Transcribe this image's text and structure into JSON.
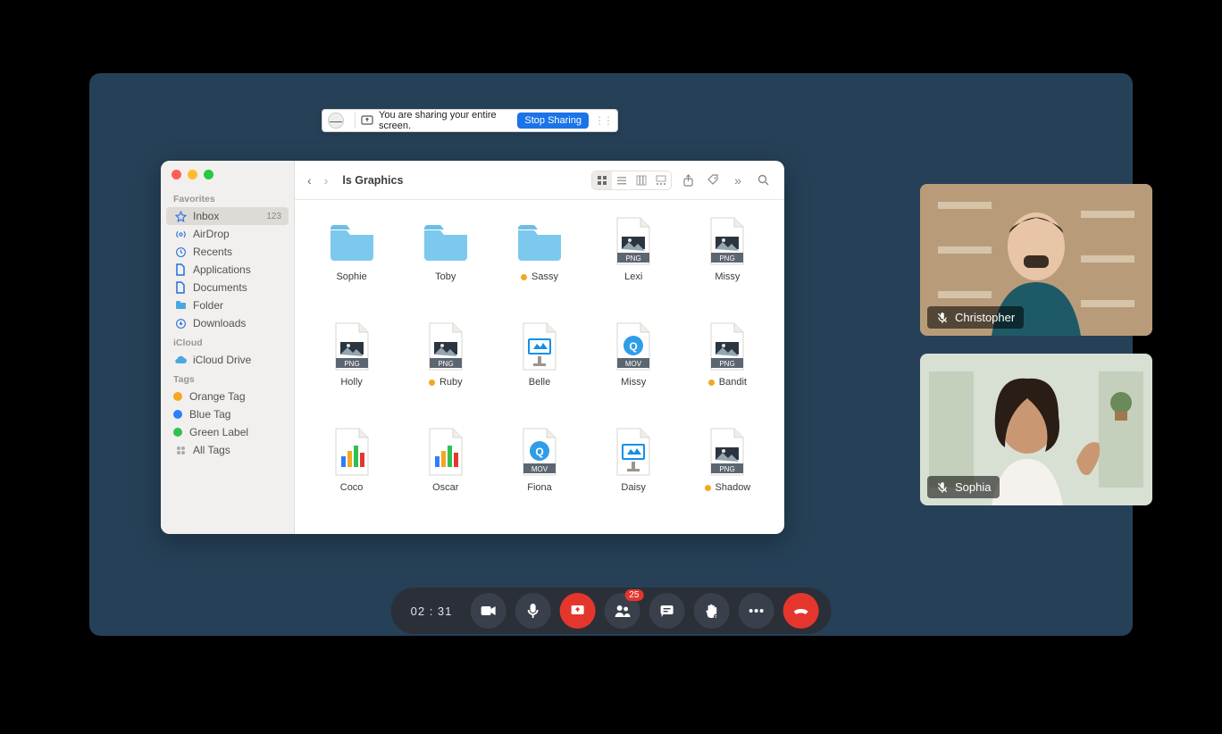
{
  "share_bar": {
    "message": "You are sharing your entire screen.",
    "stop_label": "Stop Sharing",
    "collapse_glyph": "—"
  },
  "finder": {
    "title": "ls Graphics",
    "sidebar": {
      "sections": [
        {
          "header": "Favorites",
          "items": [
            {
              "icon": "star",
              "label": "Inbox",
              "badge": "123",
              "selected": true
            },
            {
              "icon": "airdrop",
              "label": "AirDrop"
            },
            {
              "icon": "clock",
              "label": "Recents"
            },
            {
              "icon": "doc",
              "label": "Applications"
            },
            {
              "icon": "doc",
              "label": "Documents"
            },
            {
              "icon": "folder",
              "label": "Folder"
            },
            {
              "icon": "download",
              "label": "Downloads"
            }
          ]
        },
        {
          "header": "iCloud",
          "items": [
            {
              "icon": "icloud",
              "label": "iCloud Drive"
            }
          ]
        },
        {
          "header": "Tags",
          "items": [
            {
              "icon": "tag",
              "color": "#f5a623",
              "label": "Orange Tag"
            },
            {
              "icon": "tag",
              "color": "#2d7ff9",
              "label": "Blue Tag"
            },
            {
              "icon": "tag",
              "color": "#30c04f",
              "label": "Green Label"
            },
            {
              "icon": "alltags",
              "label": "All Tags"
            }
          ]
        }
      ]
    },
    "files": [
      {
        "type": "folder",
        "name": "Sophie"
      },
      {
        "type": "folder",
        "name": "Toby"
      },
      {
        "type": "folder",
        "name": "Sassy",
        "tag": "#f5a623"
      },
      {
        "type": "png",
        "name": "Lexi"
      },
      {
        "type": "png",
        "name": "Missy"
      },
      {
        "type": "png",
        "name": "Holly"
      },
      {
        "type": "png",
        "name": "Ruby",
        "tag": "#f5a623"
      },
      {
        "type": "key",
        "name": "Belle"
      },
      {
        "type": "mov",
        "name": "Missy"
      },
      {
        "type": "png",
        "name": "Bandit",
        "tag": "#f5a623"
      },
      {
        "type": "chart",
        "name": "Coco"
      },
      {
        "type": "chart",
        "name": "Oscar"
      },
      {
        "type": "mov",
        "name": "Fiona"
      },
      {
        "type": "key",
        "name": "Daisy"
      },
      {
        "type": "png",
        "name": "Shadow",
        "tag": "#f5a623"
      }
    ]
  },
  "participants": [
    {
      "name": "Christopher",
      "muted": true
    },
    {
      "name": "Sophia",
      "muted": true
    }
  ],
  "dock": {
    "timer": "02 : 31",
    "participants_badge": "25"
  }
}
